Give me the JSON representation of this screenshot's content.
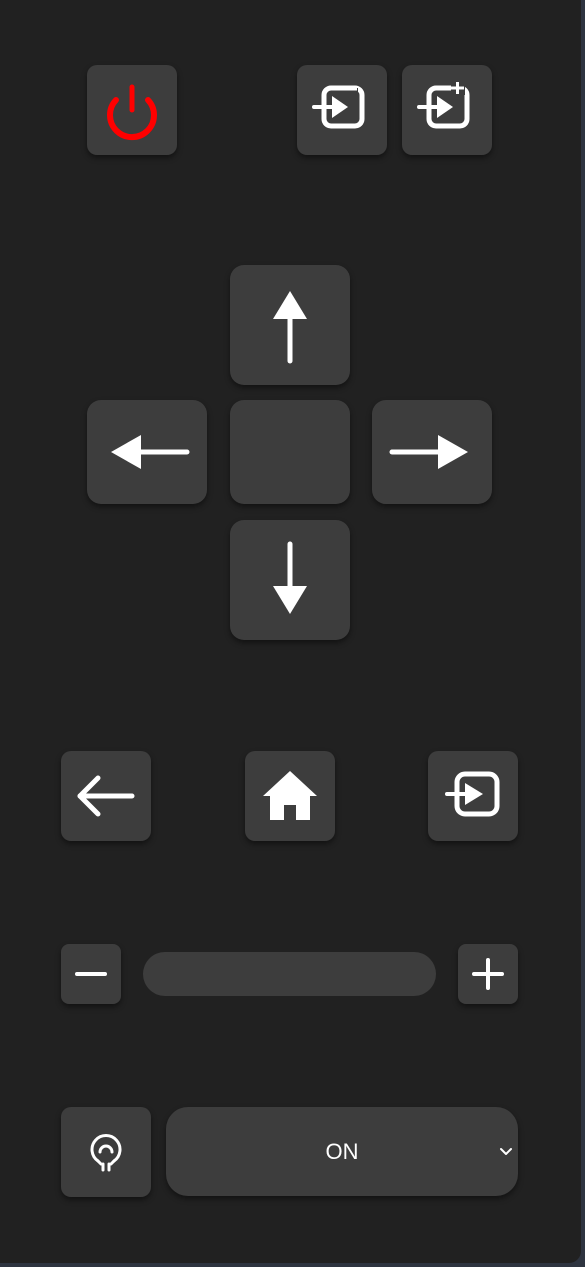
{
  "colors": {
    "panel_bg": "#212121",
    "button_bg": "#3d3d3d",
    "icon": "#ffffff",
    "power_icon": "#ff0000"
  },
  "top_row": {
    "power_icon": "power-icon",
    "input_prev_icon": "input-minus-icon",
    "input_next_icon": "input-plus-icon"
  },
  "dpad": {
    "up_icon": "arrow-up-icon",
    "left_icon": "arrow-left-icon",
    "right_icon": "arrow-right-icon",
    "down_icon": "arrow-down-icon"
  },
  "nav_row": {
    "back_icon": "back-arrow-icon",
    "home_icon": "home-icon",
    "input_icon": "input-source-icon"
  },
  "volume": {
    "minus_icon": "minus-icon",
    "plus_icon": "plus-icon"
  },
  "mode": {
    "icon": "lightbulb-icon",
    "selected": "ON"
  }
}
